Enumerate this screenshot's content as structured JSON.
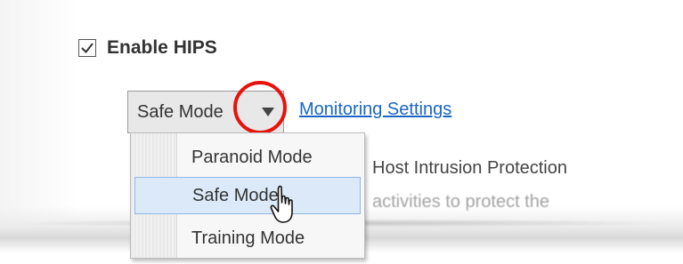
{
  "hips": {
    "checkbox_checked": true,
    "label": "Enable HIPS"
  },
  "mode_select": {
    "selected_value": "Safe Mode",
    "options": [
      "Paranoid Mode",
      "Safe Mode",
      "Training Mode"
    ],
    "highlighted_option": "Safe Mode"
  },
  "monitoring_link": {
    "label": "Monitoring Settings"
  },
  "description": {
    "line1": "Host Intrusion Protection",
    "line2": "activities to protect the"
  },
  "colors": {
    "accent_highlight_circle": "#e8120c",
    "link": "#1a66c2",
    "selected_option_bg": "#dbe9f8"
  },
  "icons": {
    "checkbox": "checkmark-icon",
    "dropdown": "triangle-down-icon",
    "cursor": "hand-pointer-icon"
  }
}
